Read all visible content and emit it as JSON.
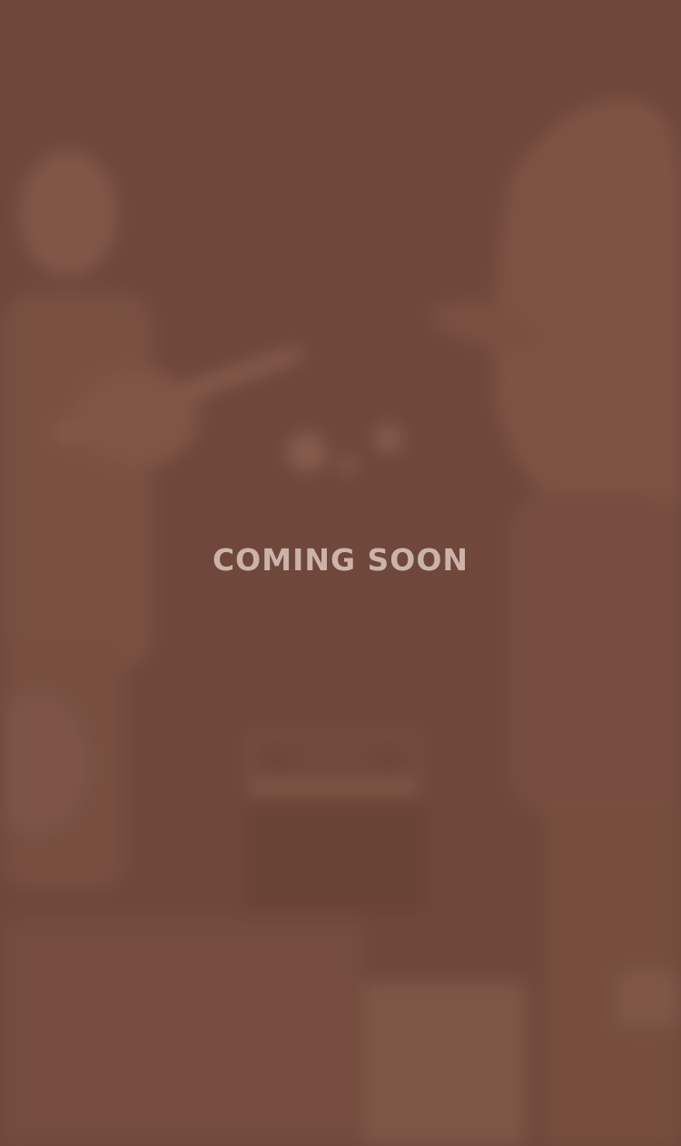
{
  "background": {
    "photo": "blurred-concert-photo",
    "amp_brand": "Marshall"
  },
  "headline": {
    "text": "COMING SOON"
  },
  "colors": {
    "background": "#6f473b",
    "text": "#cbb3a8"
  }
}
